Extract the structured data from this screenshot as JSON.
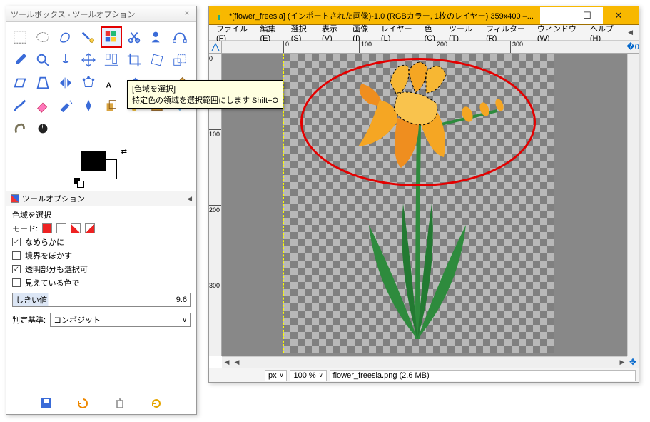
{
  "toolbox": {
    "title": "ツールボックス - ツールオプション",
    "selected_tool_index": 12,
    "tooltip": {
      "title": "[色域を選択]",
      "desc": "特定色の領域を選択範囲にします Shift+O"
    },
    "options_header": "ツールオプション",
    "options_title": "色域を選択",
    "mode_label": "モード:",
    "smoothing": "なめらかに",
    "feather": "境界をぼかす",
    "select_transparent": "透明部分も選択可",
    "visible_color": "見えている色で",
    "threshold_label": "しきい値",
    "threshold_value": "9.6",
    "criterion_label": "判定基準:",
    "criterion_value": "コンポジット",
    "checks": {
      "smoothing": true,
      "feather": false,
      "select_transparent": true,
      "visible_color": false
    }
  },
  "image_window": {
    "title": "*[flower_freesia] (インポートされた画像)-1.0 (RGBカラー, 1枚のレイヤー) 359x400 –...",
    "menu": [
      "ファイル(F)",
      "編集(E)",
      "選択(S)",
      "表示(V)",
      "画像(I)",
      "レイヤー(L)",
      "色(C)",
      "ツール(T)",
      "フィルター(R)",
      "ウィンドウ(W)",
      "ヘルプ(H)"
    ],
    "ruler_h": [
      "0",
      "100",
      "200",
      "300"
    ],
    "ruler_v": [
      "0",
      "100",
      "200",
      "300"
    ],
    "status": {
      "unit": "px",
      "zoom": "100 %",
      "filename": "flower_freesia.png (2.6 MB)"
    }
  }
}
